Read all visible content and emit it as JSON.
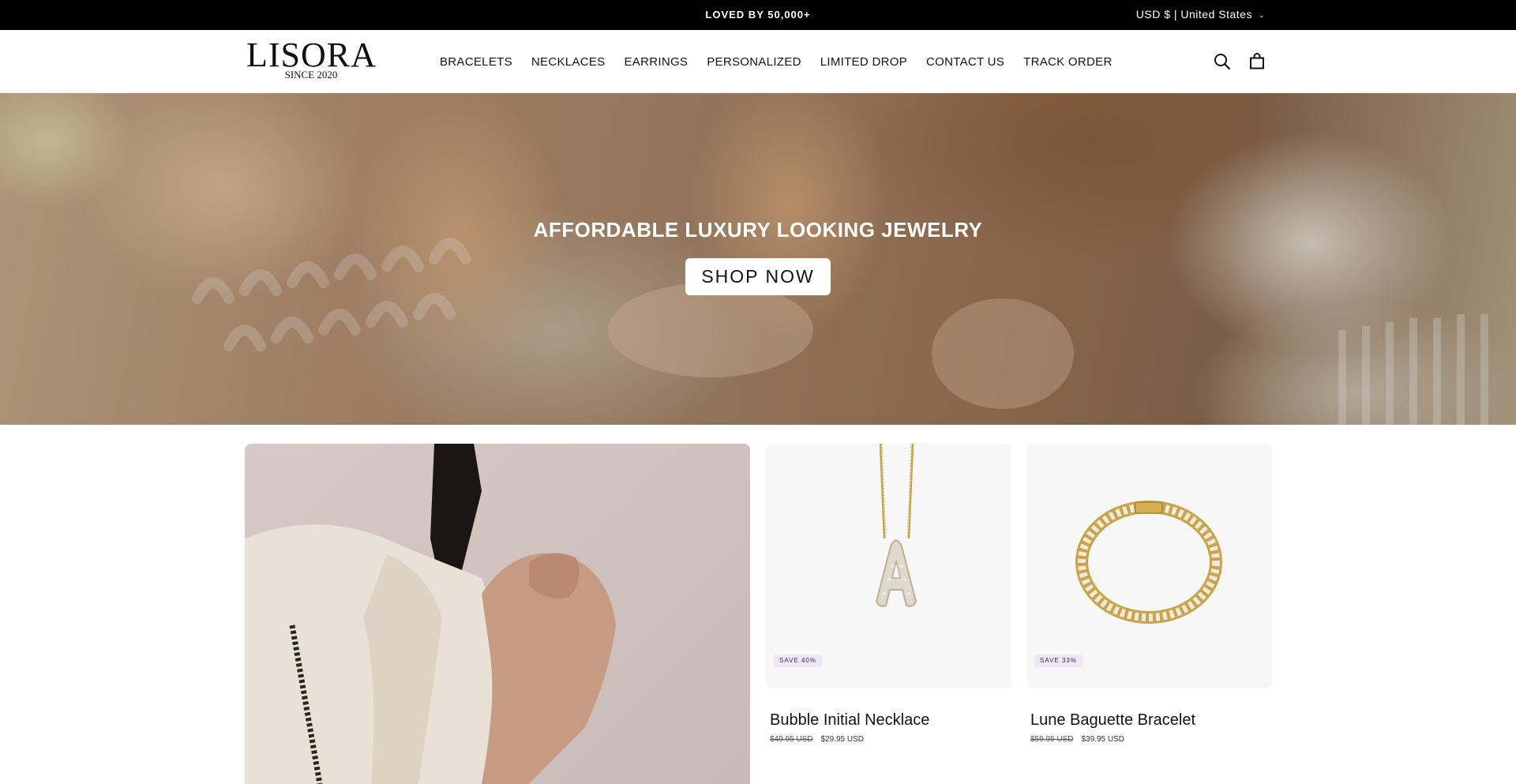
{
  "announcement": {
    "text": "LOVED BY 50,000+",
    "currency_label": "USD $ | United States",
    "chevron_glyph": "⌄"
  },
  "header": {
    "logo_main": "LISORA",
    "logo_sub": "SINCE 2020",
    "nav": [
      {
        "label": "BRACELETS"
      },
      {
        "label": "NECKLACES"
      },
      {
        "label": "EARRINGS"
      },
      {
        "label": "PERSONALIZED"
      },
      {
        "label": "LIMITED DROP"
      },
      {
        "label": "CONTACT US"
      },
      {
        "label": "TRACK ORDER"
      }
    ],
    "icons": [
      "search-icon",
      "cart-icon"
    ]
  },
  "hero": {
    "title": "AFFORDABLE LUXURY LOOKING JEWELRY",
    "button_label": "SHOP NOW"
  },
  "products": [
    {
      "title": "Bubble Initial Necklace",
      "badge": "SAVE 40%",
      "old_price": "$49.95 USD",
      "price": "$29.95 USD"
    },
    {
      "title": "Lune Baguette Bracelet",
      "badge": "SAVE 33%",
      "old_price": "$59.95 USD",
      "price": "$39.95 USD"
    }
  ],
  "colors": {
    "announcement_bg": "#000000",
    "badge_bg": "#ece8f6",
    "gold": "#c9a448"
  }
}
